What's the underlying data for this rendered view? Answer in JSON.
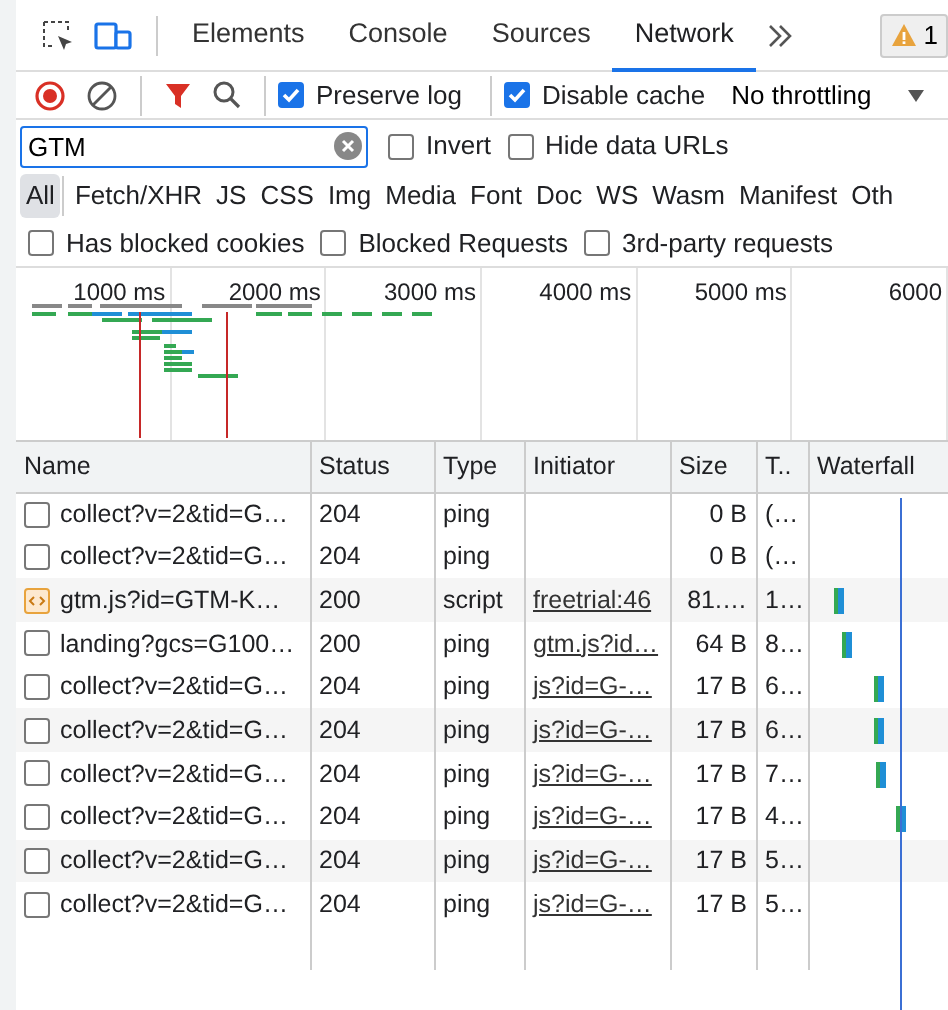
{
  "panel_tabs": [
    {
      "label": "Elements",
      "selected": false
    },
    {
      "label": "Console",
      "selected": false
    },
    {
      "label": "Sources",
      "selected": false
    },
    {
      "label": "Network",
      "selected": true
    }
  ],
  "warning_count": "1",
  "toolbar": {
    "recording": true,
    "preserve_log": {
      "label": "Preserve log",
      "checked": true
    },
    "disable_cache": {
      "label": "Disable cache",
      "checked": true
    },
    "throttling": "No throttling"
  },
  "filter": {
    "value": "GTM",
    "invert": {
      "label": "Invert",
      "checked": false
    },
    "hide_data_urls": {
      "label": "Hide data URLs",
      "checked": false
    }
  },
  "type_filters": [
    {
      "label": "All",
      "selected": true
    },
    {
      "label": "Fetch/XHR",
      "selected": false
    },
    {
      "label": "JS",
      "selected": false
    },
    {
      "label": "CSS",
      "selected": false
    },
    {
      "label": "Img",
      "selected": false
    },
    {
      "label": "Media",
      "selected": false
    },
    {
      "label": "Font",
      "selected": false
    },
    {
      "label": "Doc",
      "selected": false
    },
    {
      "label": "WS",
      "selected": false
    },
    {
      "label": "Wasm",
      "selected": false
    },
    {
      "label": "Manifest",
      "selected": false
    },
    {
      "label": "Oth",
      "selected": false
    }
  ],
  "extra_filters": [
    {
      "label": "Has blocked cookies",
      "checked": false
    },
    {
      "label": "Blocked Requests",
      "checked": false
    },
    {
      "label": "3rd-party requests",
      "checked": false
    }
  ],
  "timeline": {
    "ticks": [
      "1000 ms",
      "2000 ms",
      "3000 ms",
      "4000 ms",
      "5000 ms",
      "6000"
    ]
  },
  "table": {
    "columns": [
      "Name",
      "Status",
      "Type",
      "Initiator",
      "Size",
      "T..",
      "Waterfall"
    ],
    "rows": [
      {
        "kind": "ping",
        "name": "collect?v=2&tid=G…",
        "status": "204",
        "type": "ping",
        "size": "0 B",
        "time": "(…"
      },
      {
        "kind": "ping",
        "name": "collect?v=2&tid=G…",
        "status": "204",
        "type": "ping",
        "size": "0 B",
        "time": "(…"
      },
      {
        "kind": "script",
        "name": "gtm.js?id=GTM-K…",
        "status": "200",
        "type": "script",
        "initiator": "freetrial:46",
        "size": "81.…",
        "time": "1…",
        "level": 0.2
      },
      {
        "kind": "ping",
        "name": "landing?gcs=G100…",
        "status": "200",
        "type": "ping",
        "initiator": "gtm.js?id…",
        "size": "64 B",
        "time": "8…",
        "level": 0.27
      },
      {
        "kind": "ping",
        "name": "collect?v=2&tid=G…",
        "status": "204",
        "type": "ping",
        "initiator": "js?id=G-…",
        "size": "17 B",
        "time": "6…",
        "level": 0.53
      },
      {
        "kind": "ping",
        "name": "collect?v=2&tid=G…",
        "status": "204",
        "type": "ping",
        "initiator": "js?id=G-…",
        "size": "17 B",
        "time": "6…",
        "level": 0.53
      },
      {
        "kind": "ping",
        "name": "collect?v=2&tid=G…",
        "status": "204",
        "type": "ping",
        "initiator": "js?id=G-…",
        "size": "17 B",
        "time": "7…",
        "level": 0.54
      },
      {
        "kind": "ping",
        "name": "collect?v=2&tid=G…",
        "status": "204",
        "type": "ping",
        "initiator": "js?id=G-…",
        "size": "17 B",
        "time": "4…",
        "level": 0.7
      },
      {
        "kind": "ping",
        "name": "collect?v=2&tid=G…",
        "status": "204",
        "type": "ping",
        "initiator": "js?id=G-…",
        "size": "17 B",
        "time": "5…"
      },
      {
        "kind": "ping",
        "name": "collect?v=2&tid=G…",
        "status": "204",
        "type": "ping",
        "initiator": "js?id=G-…",
        "size": "17 B",
        "time": "5…"
      }
    ]
  }
}
